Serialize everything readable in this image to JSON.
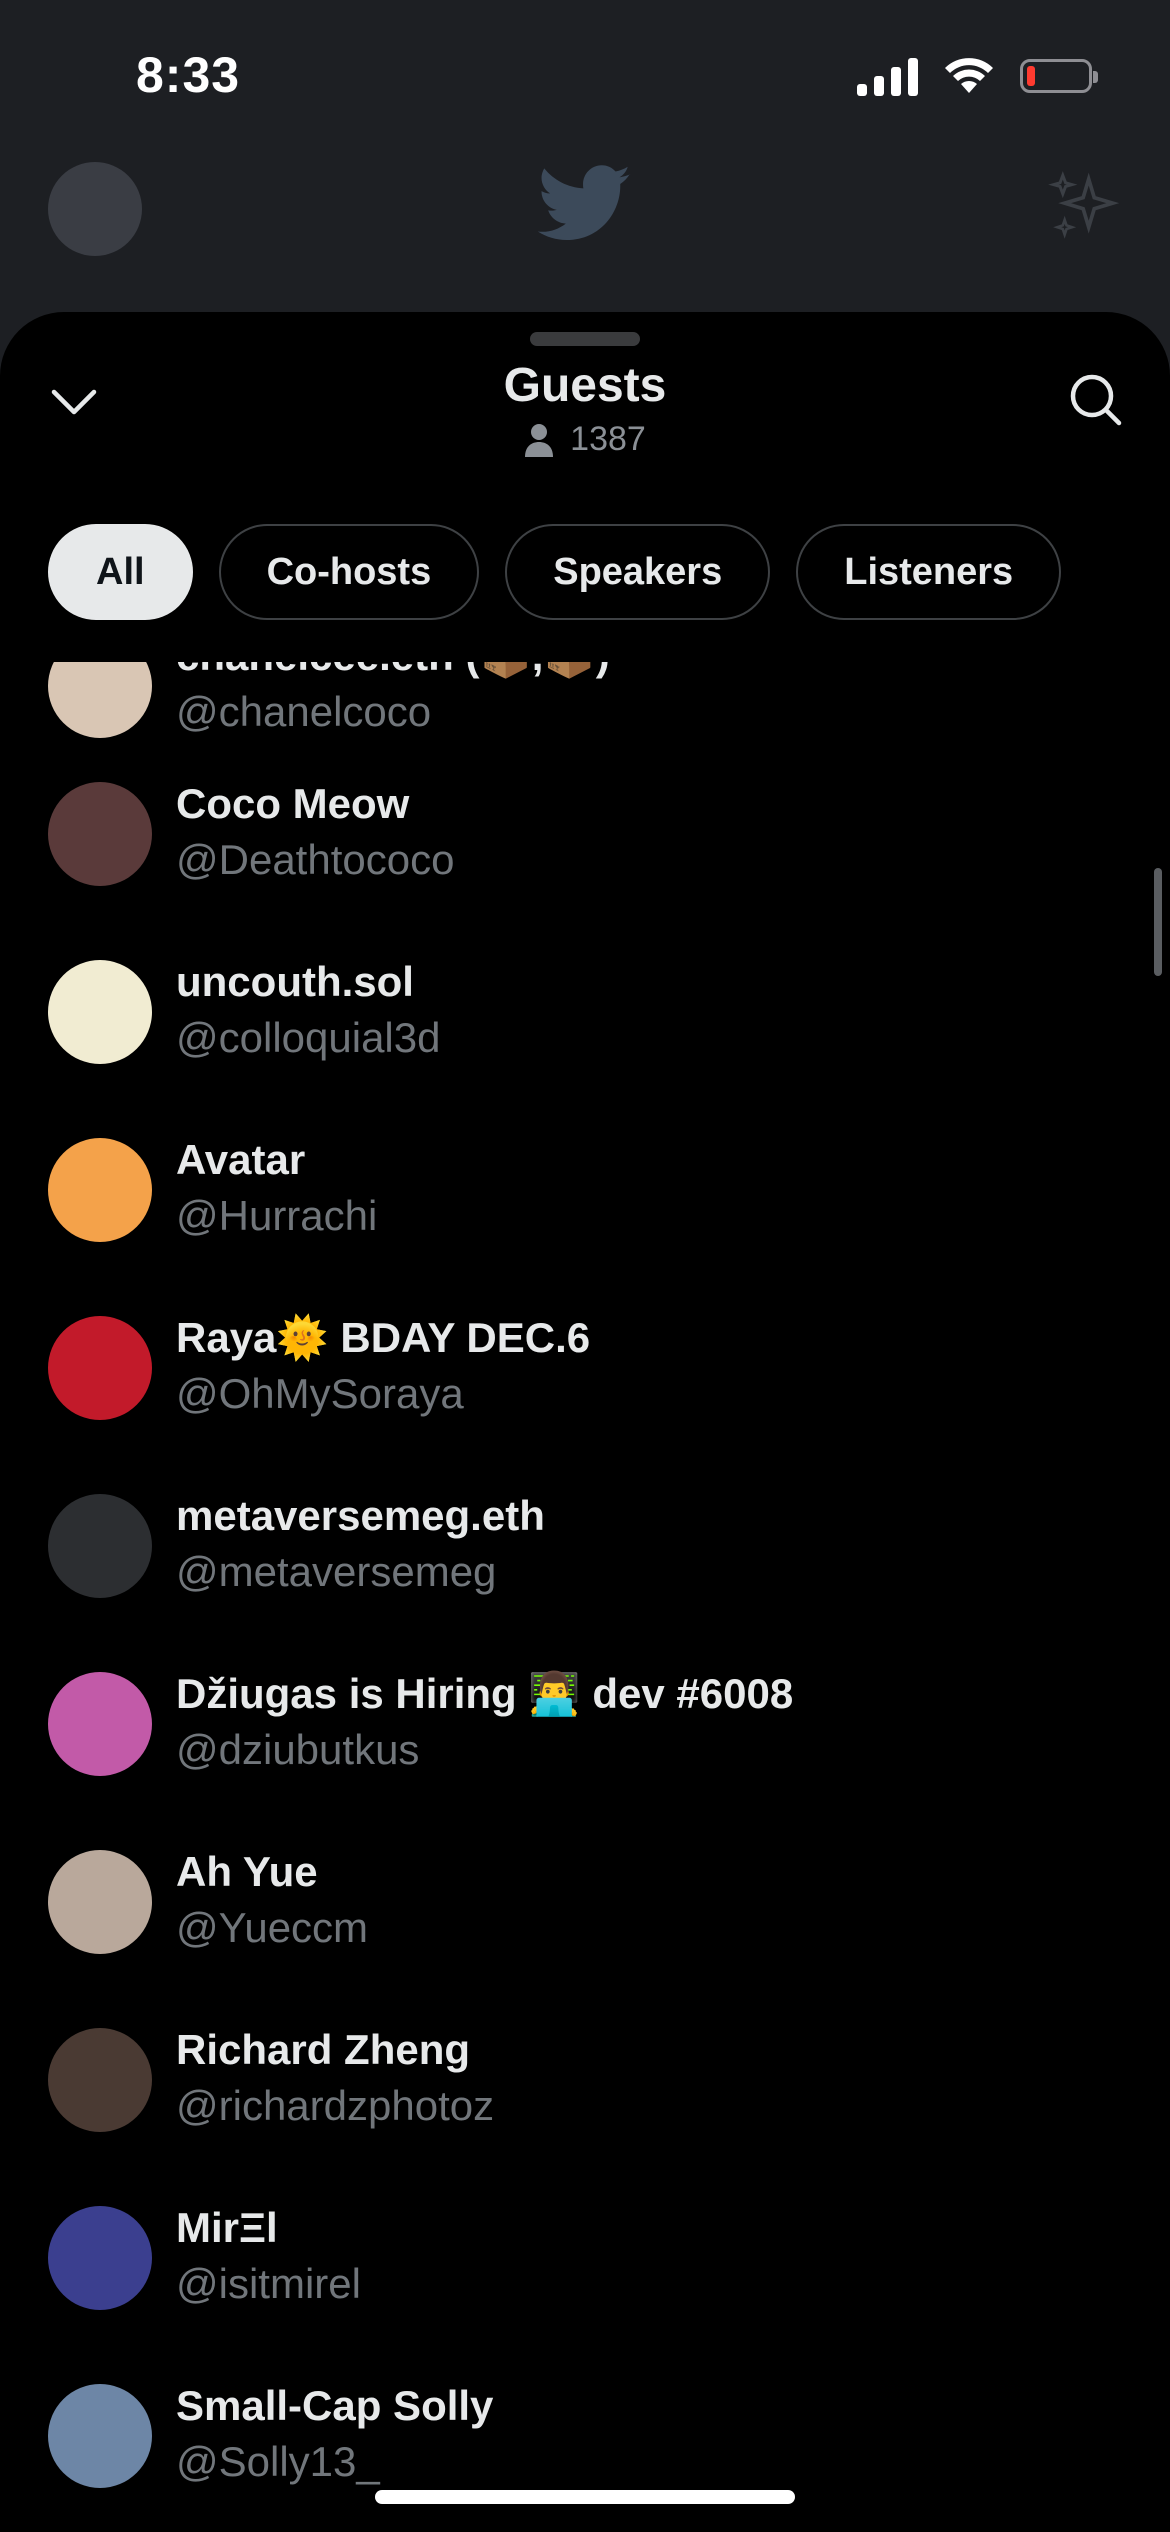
{
  "status_bar": {
    "time": "8:33"
  },
  "sheet": {
    "title": "Guests",
    "listener_count": "1387",
    "tabs": [
      {
        "label": "All",
        "active": true
      },
      {
        "label": "Co-hosts",
        "active": false
      },
      {
        "label": "Speakers",
        "active": false
      },
      {
        "label": "Listeners",
        "active": false
      }
    ]
  },
  "guests": [
    {
      "name": "chanelcee.eth (📦,📦)",
      "handle": "@chanelcoco",
      "avatar_color": "#d9c6b4"
    },
    {
      "name": "Coco Meow",
      "handle": "@Deathtococo",
      "avatar_color": "#5a3a3a"
    },
    {
      "name": "uncouth.sol",
      "handle": "@colloquial3d",
      "avatar_color": "#f1ecd2"
    },
    {
      "name": "Avatar",
      "handle": "@Hurrachi",
      "avatar_color": "#f4a24a"
    },
    {
      "name": "Raya🌞 BDAY DEC.6",
      "handle": "@OhMySoraya",
      "avatar_color": "#c21a2a"
    },
    {
      "name": "metaversemeg.eth",
      "handle": "@metaversemeg",
      "avatar_color": "#2c2e31"
    },
    {
      "name": "Džiugas is Hiring 👨‍💻 dev #6008",
      "handle": "@dziubutkus",
      "avatar_color": "#c25aa8"
    },
    {
      "name": "Ah Yue",
      "handle": "@Yueccm",
      "avatar_color": "#b9a89b"
    },
    {
      "name": "Richard Zheng",
      "handle": "@richardzphotoz",
      "avatar_color": "#4a3a33"
    },
    {
      "name": "MirΞl",
      "handle": "@isitmirel",
      "avatar_color": "#3b3f8f"
    },
    {
      "name": "Small-Cap Solly",
      "handle": "@Solly13_",
      "avatar_color": "#6d86a6"
    }
  ]
}
